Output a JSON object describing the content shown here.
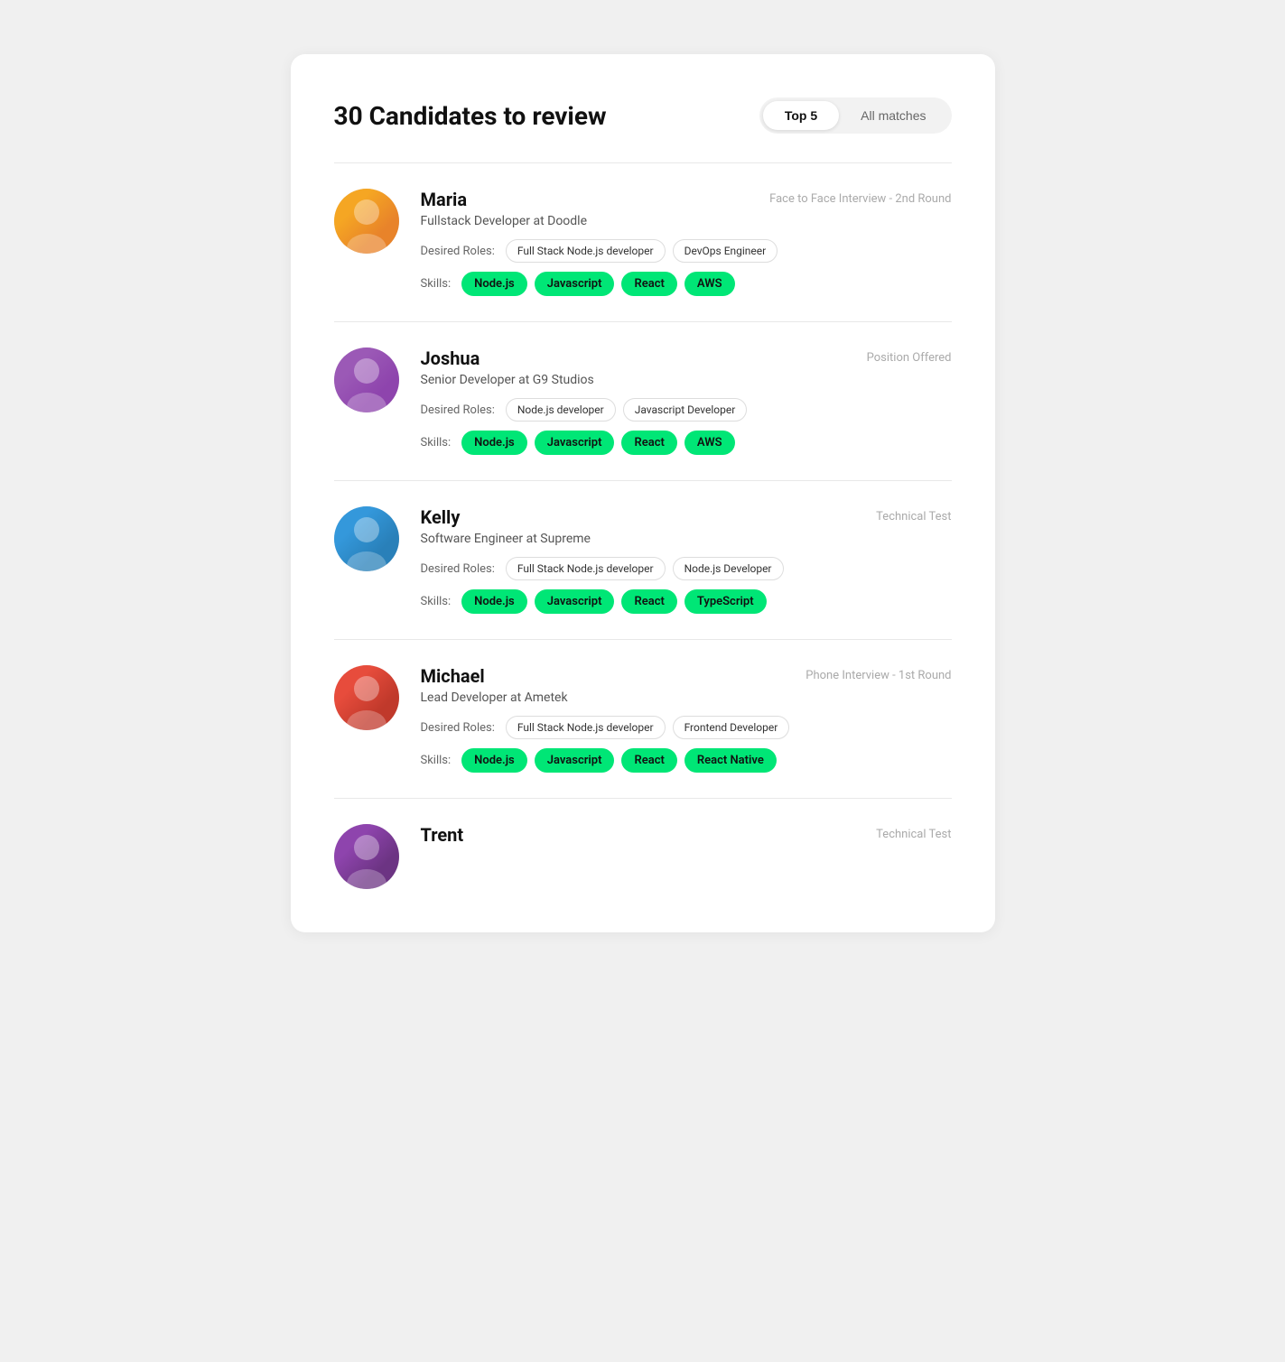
{
  "header": {
    "title": "30 Candidates to review",
    "toggle": {
      "top_label": "Top 5",
      "all_label": "All matches",
      "active": "top"
    }
  },
  "candidates": [
    {
      "id": "maria",
      "name": "Maria",
      "title": "Fullstack Developer at Doodle",
      "stage": "Face to Face Interview - 2nd Round",
      "desired_roles": [
        "Full Stack Node.js developer",
        "DevOps Engineer"
      ],
      "skills": [
        "Node.js",
        "Javascript",
        "React",
        "AWS"
      ],
      "avatar_class": "avatar-maria"
    },
    {
      "id": "joshua",
      "name": "Joshua",
      "title": "Senior Developer at G9 Studios",
      "stage": "Position Offered",
      "desired_roles": [
        "Node.js developer",
        "Javascript Developer"
      ],
      "skills": [
        "Node.js",
        "Javascript",
        "React",
        "AWS"
      ],
      "avatar_class": "avatar-joshua"
    },
    {
      "id": "kelly",
      "name": "Kelly",
      "title": "Software Engineer at Supreme",
      "stage": "Technical Test",
      "desired_roles": [
        "Full Stack Node.js developer",
        "Node.js Developer"
      ],
      "skills": [
        "Node.js",
        "Javascript",
        "React",
        "TypeScript"
      ],
      "avatar_class": "avatar-kelly"
    },
    {
      "id": "michael",
      "name": "Michael",
      "title": "Lead Developer at Ametek",
      "stage": "Phone Interview - 1st Round",
      "desired_roles": [
        "Full Stack Node.js developer",
        "Frontend Developer"
      ],
      "skills": [
        "Node.js",
        "Javascript",
        "React",
        "React Native"
      ],
      "avatar_class": "avatar-michael"
    },
    {
      "id": "trent",
      "name": "Trent",
      "title": "",
      "stage": "Technical Test",
      "desired_roles": [],
      "skills": [],
      "avatar_class": "avatar-trent"
    }
  ],
  "labels": {
    "desired_roles": "Desired Roles:",
    "skills": "Skills:"
  }
}
